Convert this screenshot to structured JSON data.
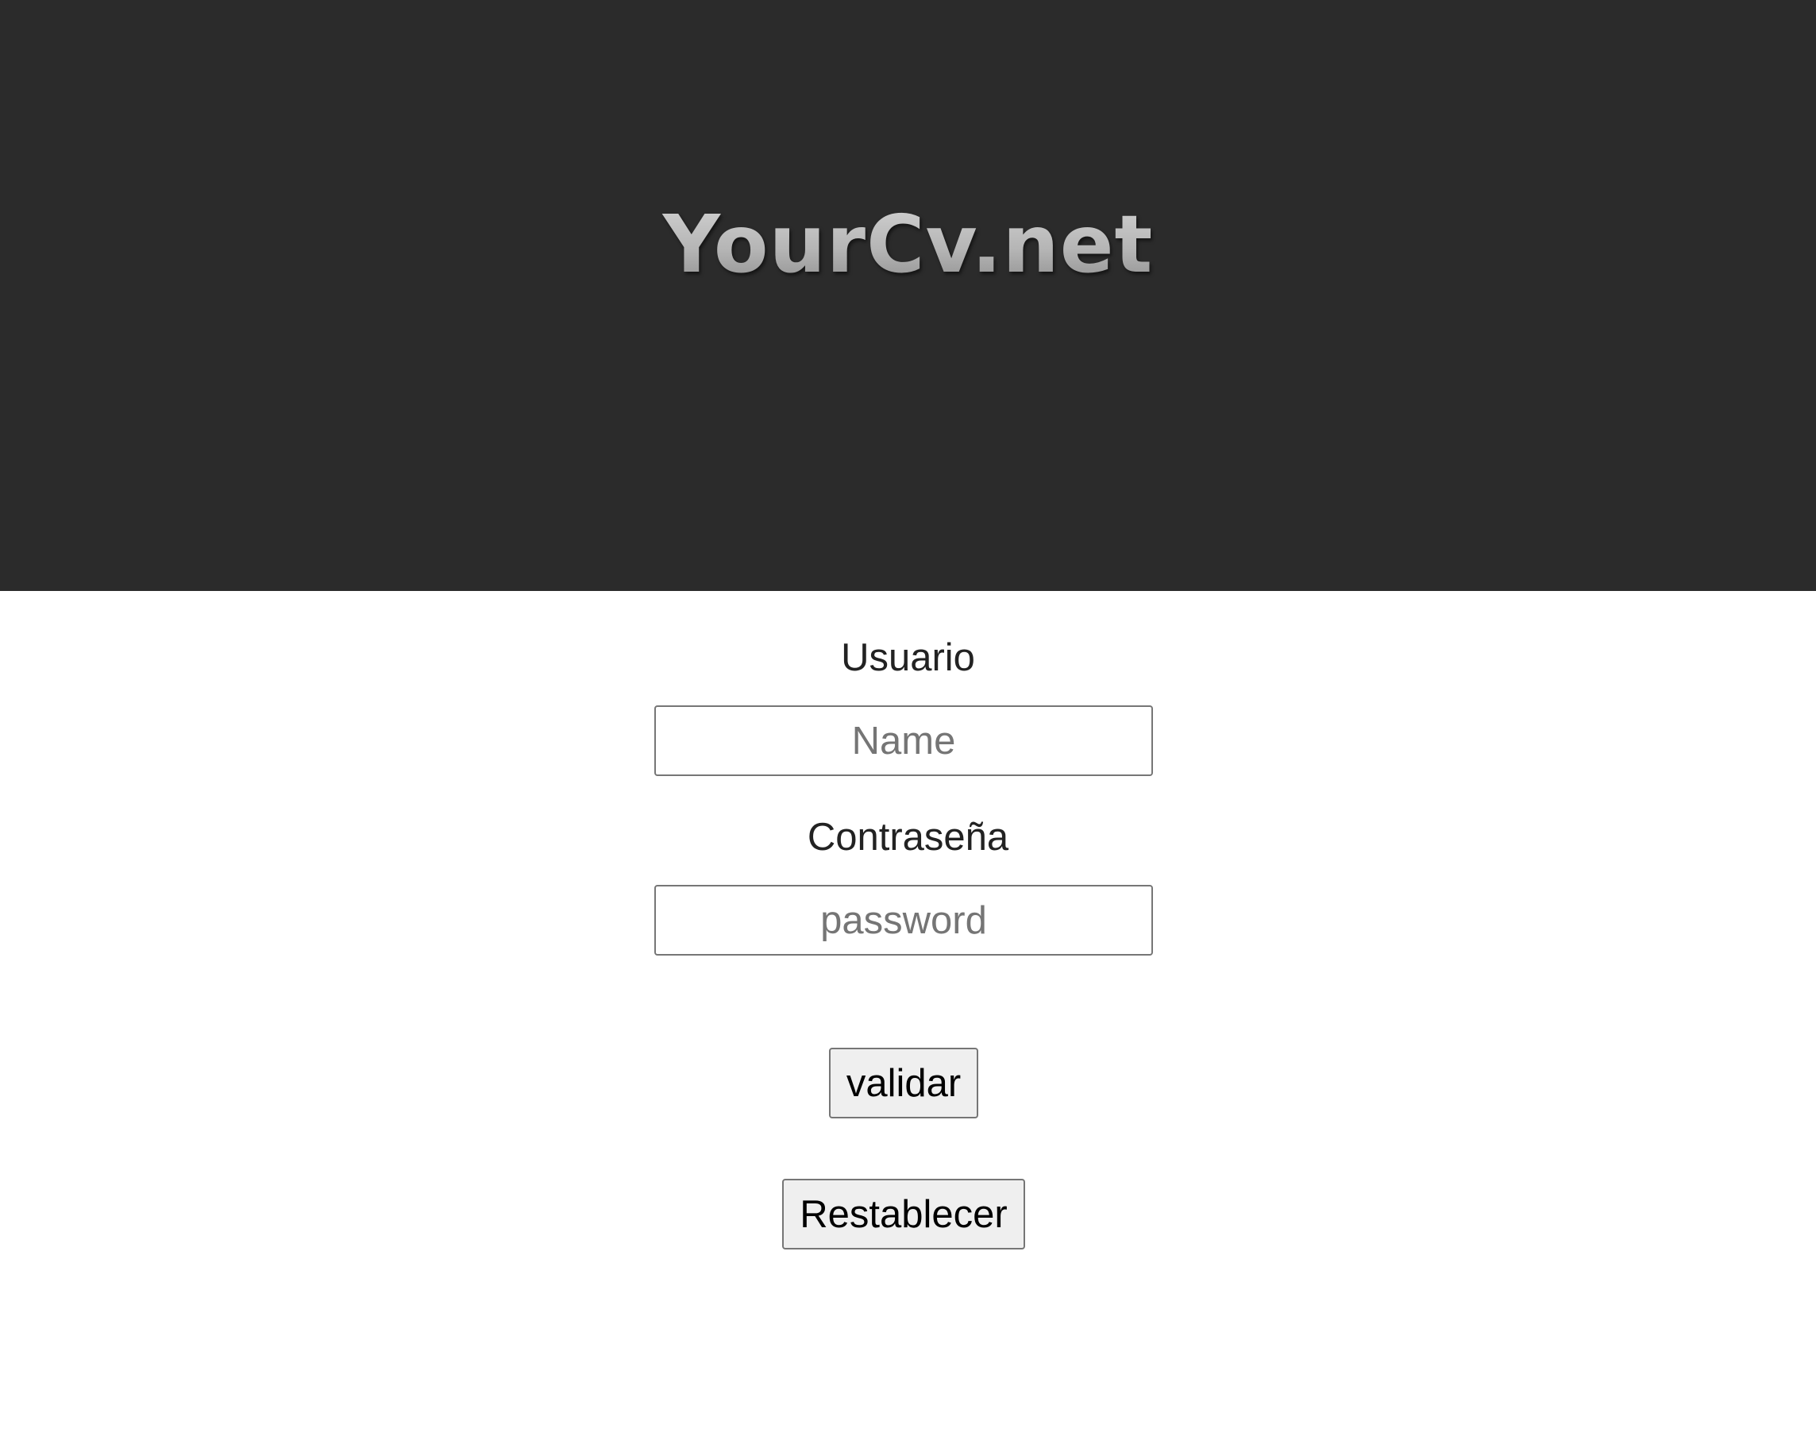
{
  "header": {
    "logo_text": "YourCv.net"
  },
  "login_form": {
    "username_label": "Usuario",
    "username_placeholder": "Name",
    "password_label": "Contraseña",
    "password_placeholder": "password",
    "validate_button": "validar",
    "reset_button": "Restablecer"
  },
  "colors": {
    "header_background": "#2b2b2b",
    "page_background": "#ffffff",
    "button_background": "#efefef"
  }
}
